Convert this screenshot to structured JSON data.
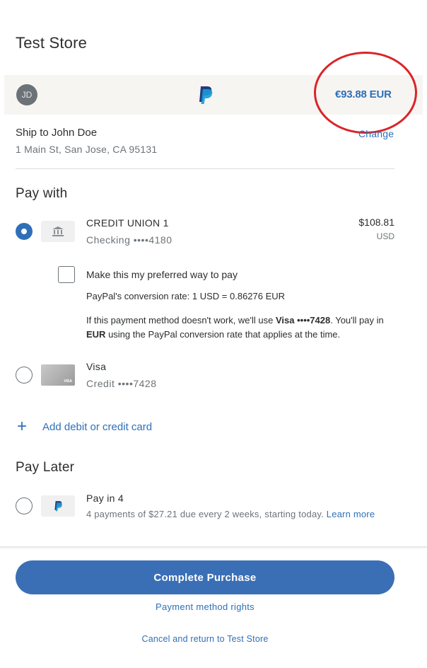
{
  "store": {
    "title": "Test Store"
  },
  "header": {
    "avatar_initials": "JD",
    "logo_icon": "paypal-logo-icon",
    "total": "€93.88 EUR"
  },
  "shipping": {
    "name": "Ship to John Doe",
    "address": "1 Main St, San Jose, CA 95131",
    "change_label": "Change"
  },
  "pay_with": {
    "heading": "Pay with",
    "methods": [
      {
        "name": "CREDIT UNION 1",
        "detail": "Checking ••••4180",
        "amount": "$108.81",
        "currency": "USD",
        "selected": true,
        "icon": "bank-icon"
      },
      {
        "name": "Visa",
        "detail": "Credit ••••7428",
        "selected": false,
        "icon": "visa-card-icon"
      }
    ],
    "preferred_label": "Make this my preferred way to pay",
    "preferred_checked": false,
    "conversion_rate": "PayPal's conversion rate: 1 USD = 0.86276 EUR",
    "fallback_text_1": "If this payment method doesn't work, we'll use ",
    "fallback_card": "Visa ••••7428",
    "fallback_text_2": ". You'll pay in ",
    "fallback_currency": "EUR",
    "fallback_text_3": " using the PayPal conversion rate that applies at the time.",
    "add_card_label": "Add debit or credit card"
  },
  "pay_later": {
    "heading": "Pay Later",
    "option_name": "Pay in 4",
    "option_detail": "4 payments of $27.21 due every 2 weeks, starting today.",
    "learn_more": "Learn more",
    "selected": false
  },
  "footer": {
    "complete_label": "Complete Purchase",
    "rights_label": "Payment method rights",
    "cancel_label": "Cancel and return to Test Store"
  },
  "colors": {
    "accent": "#2f6fb8",
    "button": "#3a6fb6",
    "annotation": "#d9252a"
  }
}
